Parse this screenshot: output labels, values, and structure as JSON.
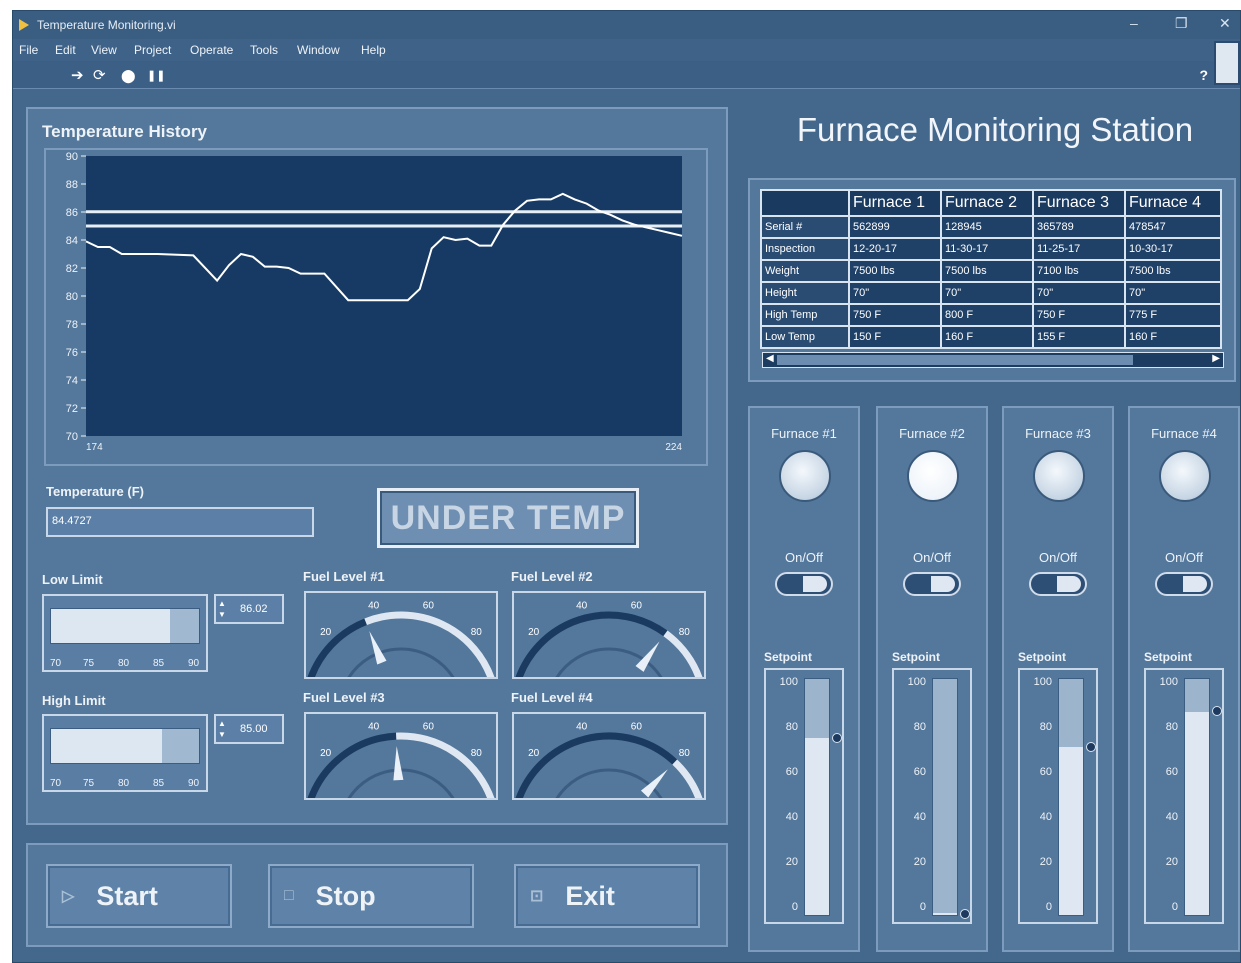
{
  "window": {
    "title": "Temperature Monitoring.vi",
    "min_glyph": "–",
    "restore_glyph": "❐",
    "close_glyph": "✕"
  },
  "menu": [
    "File",
    "Edit",
    "View",
    "Project",
    "Operate",
    "Tools",
    "Window",
    "Help"
  ],
  "toolbar": {
    "icons": [
      "run-arrow-icon",
      "run-continuous-icon",
      "abort-icon",
      "pause-icon"
    ],
    "glyphs": [
      "➔",
      "⟳",
      "⬤",
      "❚❚"
    ],
    "help": "?"
  },
  "history": {
    "title": "Temperature History"
  },
  "chart_data": {
    "type": "line",
    "title": "Temperature History",
    "xlabel": "",
    "ylabel": "",
    "xlim": [
      174,
      224
    ],
    "ylim": [
      70,
      90
    ],
    "x_ticks": [
      "174",
      "224"
    ],
    "y_ticks": [
      "90",
      "88",
      "86",
      "84",
      "82",
      "80",
      "78",
      "76",
      "74",
      "72",
      "70"
    ],
    "grid": false,
    "series": [
      {
        "x": [
          174,
          175,
          176,
          177,
          178,
          180,
          183,
          185,
          186,
          187,
          188,
          189,
          190,
          191,
          192,
          193,
          194,
          196,
          197,
          198,
          199,
          200,
          201,
          202,
          203,
          204,
          205,
          206,
          207,
          208,
          209,
          210,
          211,
          212,
          213,
          214,
          215,
          216,
          217,
          218,
          219,
          220,
          221,
          222,
          223,
          224
        ],
        "y": [
          83.9,
          83.5,
          83.5,
          83.0,
          83.0,
          83.0,
          82.9,
          81.1,
          82.2,
          83.0,
          82.8,
          82.1,
          82.1,
          82.0,
          81.6,
          81.6,
          81.6,
          79.7,
          79.7,
          79.7,
          79.7,
          79.7,
          79.7,
          80.5,
          83.4,
          84.2,
          84.0,
          84.1,
          83.6,
          83.6,
          85.1,
          86.1,
          86.8,
          86.9,
          86.9,
          87.3,
          86.9,
          86.6,
          86.1,
          85.8,
          85.4,
          85.1,
          84.9,
          84.7,
          84.5,
          84.3
        ]
      },
      {
        "values": [
          86.02,
          86.02
        ]
      },
      {
        "values": [
          85.0,
          85.0
        ]
      }
    ]
  },
  "temperature": {
    "label": "Temperature (F)",
    "value": "84.4727"
  },
  "status": {
    "text": "UNDER TEMP"
  },
  "low_limit": {
    "label": "Low Limit",
    "value": "86.02",
    "level": 86.02,
    "ticks": [
      "70",
      "75",
      "80",
      "85",
      "90"
    ]
  },
  "high_limit": {
    "label": "High Limit",
    "value": "85.00",
    "level": 85.0,
    "ticks": [
      "70",
      "75",
      "80",
      "85",
      "90"
    ]
  },
  "gauges": [
    {
      "label": "Fuel Level #1",
      "value": 35
    },
    {
      "label": "Fuel Level #2",
      "value": 75
    },
    {
      "label": "Fuel Level #3",
      "value": 48
    },
    {
      "label": "Fuel Level #4",
      "value": 80
    }
  ],
  "gauge_ticks": [
    "0",
    "20",
    "40",
    "60",
    "80",
    "100"
  ],
  "buttons": {
    "start": "Start",
    "stop": "Stop",
    "exit": "Exit"
  },
  "station": {
    "title": "Furnace Monitoring Station"
  },
  "table": {
    "headers": [
      "",
      "Furnace 1",
      "Furnace 2",
      "Furnace 3",
      "Furnace 4"
    ],
    "rows": [
      [
        "Serial #",
        "562899",
        "128945",
        "365789",
        "478547"
      ],
      [
        "Inspection",
        "12-20-17",
        "11-30-17",
        "11-25-17",
        "10-30-17"
      ],
      [
        "Weight",
        "7500 lbs",
        "7500 lbs",
        "7100 lbs",
        "7500 lbs"
      ],
      [
        "Height",
        "70\"",
        "70\"",
        "70\"",
        "70\""
      ],
      [
        "High Temp",
        "750 F",
        "800 F",
        "750 F",
        "775 F"
      ],
      [
        "Low Temp",
        "150 F",
        "160 F",
        "155 F",
        "160 F"
      ]
    ]
  },
  "furnaces": [
    {
      "name": "Furnace #1",
      "onoff": "On/Off",
      "setpoint_label": "Setpoint",
      "setpoint": 75,
      "led_on": false
    },
    {
      "name": "Furnace #2",
      "onoff": "On/Off",
      "setpoint_label": "Setpoint",
      "setpoint": 1,
      "led_on": true
    },
    {
      "name": "Furnace #3",
      "onoff": "On/Off",
      "setpoint_label": "Setpoint",
      "setpoint": 71,
      "led_on": false
    },
    {
      "name": "Furnace #4",
      "onoff": "On/Off",
      "setpoint_label": "Setpoint",
      "setpoint": 86,
      "led_on": false
    }
  ],
  "setpoint_ticks": [
    "100",
    "80",
    "60",
    "40",
    "20",
    "0"
  ],
  "colors": {
    "background": "#44688c",
    "panel": "#54779c",
    "plot_bg": "#173a64",
    "trace": "#ffffff"
  }
}
